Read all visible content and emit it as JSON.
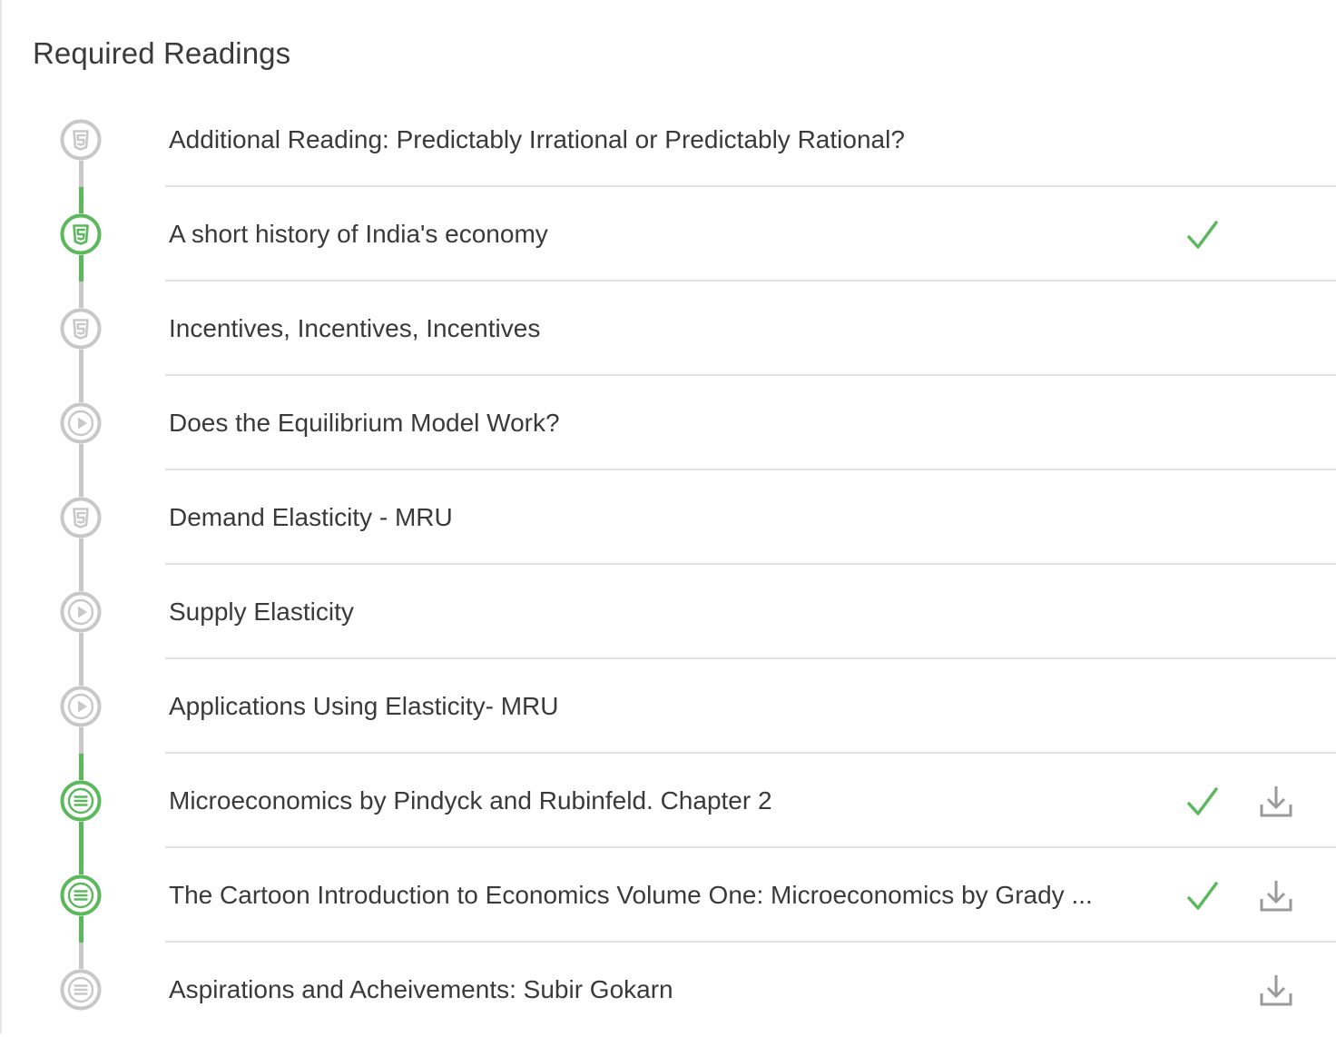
{
  "section": {
    "title": "Required Readings"
  },
  "colors": {
    "completed": "#5cb85c",
    "pending": "#c8c8c8",
    "check": "#5cb85c",
    "download": "#9a9a9a"
  },
  "items": [
    {
      "title": "Additional Reading: Predictably Irrational or Predictably Rational?",
      "icon": "html5-icon",
      "completed": false,
      "downloadable": false
    },
    {
      "title": "A short history of India's economy",
      "icon": "html5-icon",
      "completed": true,
      "downloadable": false
    },
    {
      "title": "Incentives, Incentives, Incentives",
      "icon": "html5-icon",
      "completed": false,
      "downloadable": false
    },
    {
      "title": "Does the Equilibrium Model Work?",
      "icon": "play-icon",
      "completed": false,
      "downloadable": false
    },
    {
      "title": "Demand Elasticity - MRU",
      "icon": "html5-icon",
      "completed": false,
      "downloadable": false
    },
    {
      "title": "Supply Elasticity",
      "icon": "play-icon",
      "completed": false,
      "downloadable": false
    },
    {
      "title": "Applications Using Elasticity- MRU",
      "icon": "play-icon",
      "completed": false,
      "downloadable": false
    },
    {
      "title": "Microeconomics by Pindyck and Rubinfeld. Chapter 2",
      "icon": "document-icon",
      "completed": true,
      "downloadable": true
    },
    {
      "title": "The Cartoon Introduction to Economics Volume One: Microeconomics by Grady ...",
      "icon": "document-icon",
      "completed": true,
      "downloadable": true
    },
    {
      "title": "Aspirations and Acheivements: Subir Gokarn",
      "icon": "document-icon",
      "completed": false,
      "downloadable": true
    }
  ]
}
